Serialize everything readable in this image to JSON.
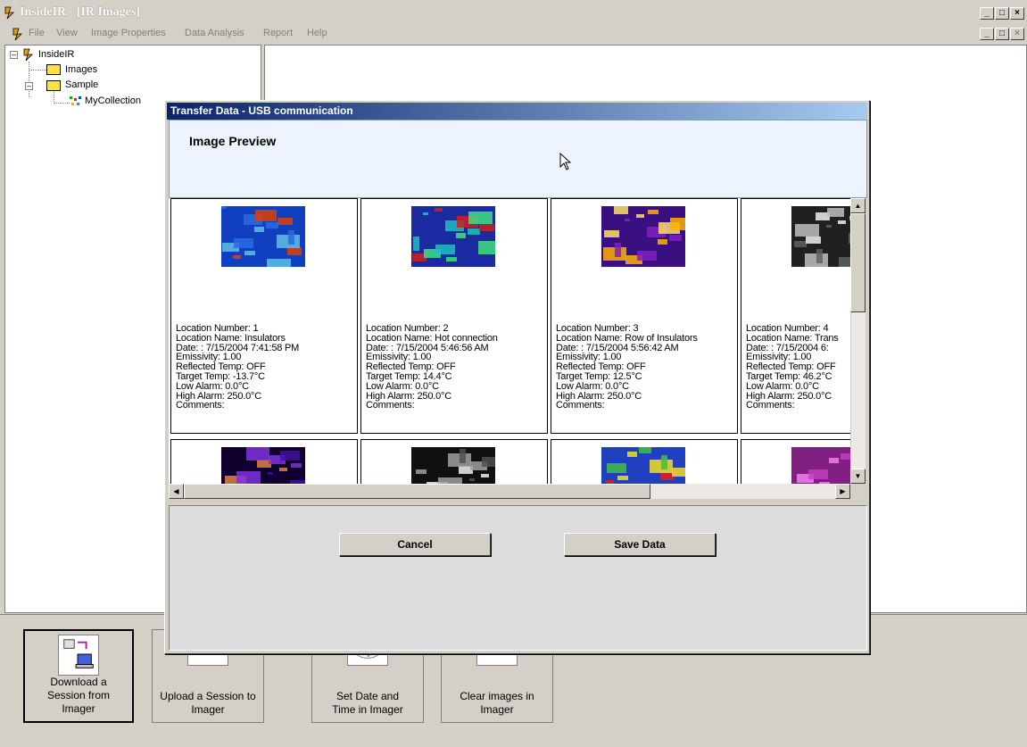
{
  "window": {
    "title": "InsideIR - [IR Images]",
    "controls": [
      "_",
      "□",
      "X"
    ]
  },
  "menu": [
    "File",
    "View",
    "Image Properties",
    "Data Analysis",
    "Report",
    "Help"
  ],
  "tree": {
    "root": "InsideIR",
    "children": [
      "Images",
      "Sample"
    ],
    "sample_children": [
      "MyCollection"
    ]
  },
  "dialog": {
    "title": "Transfer Data - USB communication",
    "preview_heading": "Image Preview",
    "cancel_label": "Cancel",
    "save_label": "Save Data"
  },
  "images": [
    {
      "location_number": "Location Number: 1",
      "location_name": "Location Name: Insulators",
      "date": "Date: : 7/15/2004 7:41:58 PM",
      "emissivity": "Emissivity: 1.00",
      "reflected": "Reflected Temp: OFF",
      "target": "Target Temp: -13.7°C",
      "low_alarm": "Low Alarm: 0.0°C",
      "high_alarm": "High Alarm: 250.0°C",
      "comments": "Comments:",
      "palette": [
        "#1040c0",
        "#2a6be0",
        "#60c0e0",
        "#e04000"
      ]
    },
    {
      "location_number": "Location Number: 2",
      "location_name": "Location Name: Hot connection",
      "date": "Date: : 7/15/2004 5:46:56 AM",
      "emissivity": "Emissivity: 1.00",
      "reflected": "Reflected Temp: OFF",
      "target": "Target Temp: 14.4°C",
      "low_alarm": "Low Alarm: 0.0°C",
      "high_alarm": "High Alarm: 250.0°C",
      "comments": "Comments:",
      "palette": [
        "#1a2aa0",
        "#20c0c0",
        "#40e080",
        "#d02020"
      ]
    },
    {
      "location_number": "Location Number: 3",
      "location_name": "Location Name: Row of Insulators",
      "date": "Date: : 7/15/2004 5:56:42 AM",
      "emissivity": "Emissivity: 1.00",
      "reflected": "Reflected Temp: OFF",
      "target": "Target Temp: 12.5°C",
      "low_alarm": "Low Alarm: 0.0°C",
      "high_alarm": "High Alarm: 250.0°C",
      "comments": "Comments:",
      "palette": [
        "#3a1080",
        "#8020c0",
        "#ffb000",
        "#ffe060"
      ]
    },
    {
      "location_number": "Location Number: 4",
      "location_name": "Location Name: Trans",
      "date": "Date: : 7/15/2004 6:",
      "emissivity": "Emissivity: 1.00",
      "reflected": "Reflected Temp: OFF",
      "target": "Target Temp: 46.2°C",
      "low_alarm": "Low Alarm: 0.0°C",
      "high_alarm": "High Alarm: 250.0°C",
      "comments": "Comments:",
      "palette": [
        "#202020",
        "#606060",
        "#c0c0c0",
        "#f0f0f0"
      ]
    }
  ],
  "row2_palettes": [
    [
      "#100030",
      "#4010a0",
      "#8030e0",
      "#e08040"
    ],
    [
      "#101010",
      "#505050",
      "#a0a0a0",
      "#f0f0f0"
    ],
    [
      "#2040c0",
      "#40c040",
      "#f0e020",
      "#e02020"
    ],
    [
      "#802080",
      "#c040c0",
      "#f080f0",
      "#ffc0ff"
    ]
  ],
  "toolbar": [
    {
      "label": "Download a Session from Imager",
      "pressed": true
    },
    {
      "label": "Upload a Session to Imager",
      "pressed": false
    },
    {
      "label": "Set Date and Time in Imager",
      "pressed": false
    },
    {
      "label": "Clear images in Imager",
      "pressed": false
    }
  ]
}
